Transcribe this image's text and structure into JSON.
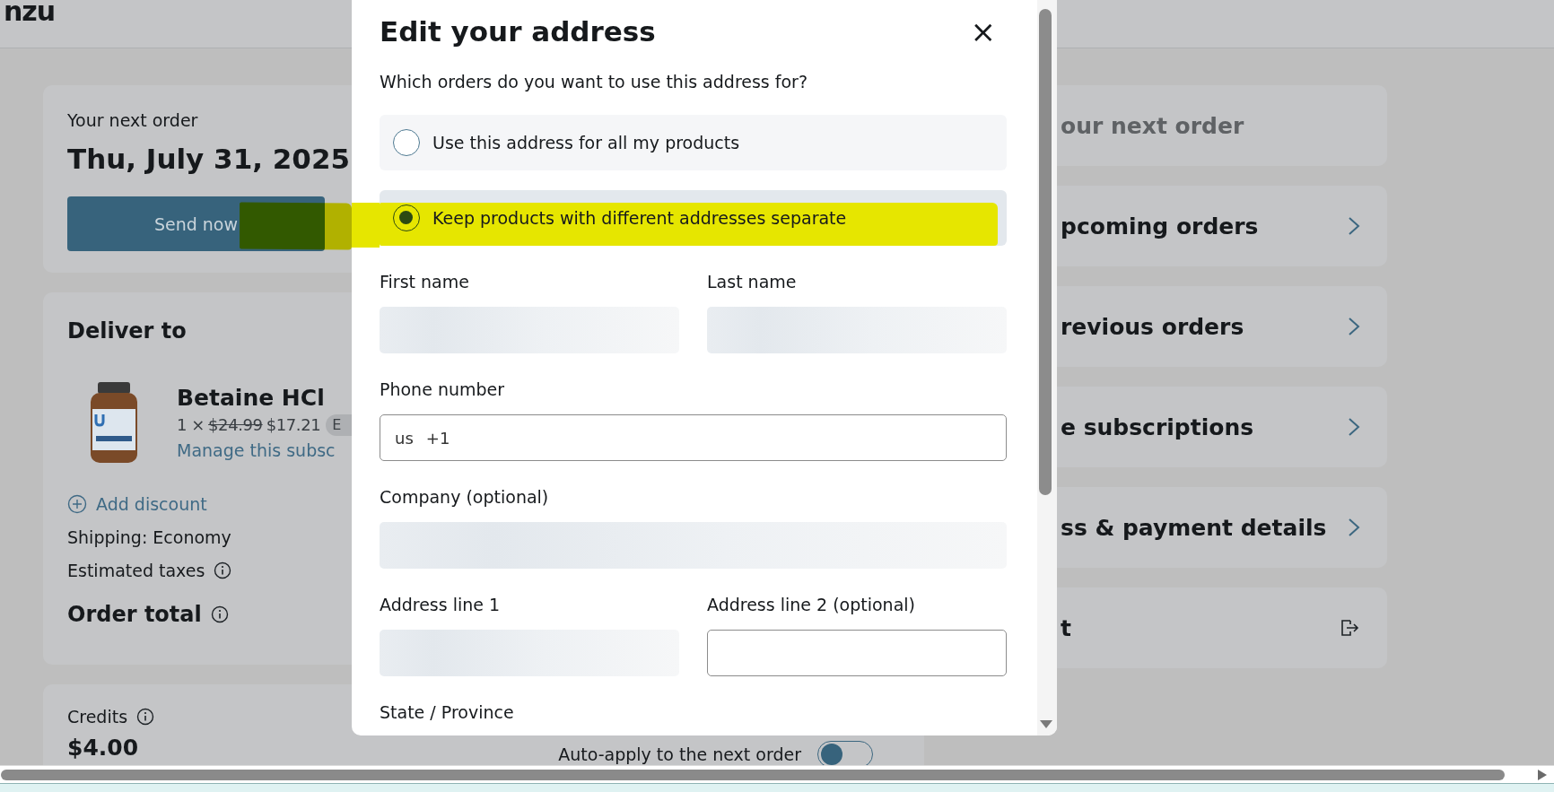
{
  "background": {
    "logo": "nzu",
    "next_order": {
      "label": "Your next order",
      "date": "Thu, July 31, 2025",
      "button": "Send now"
    },
    "delivery": {
      "title": "Deliver to",
      "product": {
        "name": "Betaine HCl",
        "quantity": "1 ×",
        "old_price": "$24.99",
        "price": "$17.21",
        "badge": "E",
        "link": "Manage this subsc"
      },
      "add_discount": "Add discount",
      "shipping": "Shipping: Economy",
      "taxes": "Estimated taxes",
      "total": "Order total"
    },
    "credits": {
      "label": "Credits",
      "amount": "$4.00",
      "auto_apply": {
        "label": "Auto-apply to the next order",
        "on": false
      }
    },
    "menu": [
      {
        "label": "our next order",
        "kind": "current"
      },
      {
        "label": "pcoming orders",
        "kind": "link"
      },
      {
        "label": "revious orders",
        "kind": "link"
      },
      {
        "label": "e subscriptions",
        "kind": "link"
      },
      {
        "label": "ss & payment details",
        "kind": "link"
      },
      {
        "label": "t",
        "kind": "logout"
      }
    ]
  },
  "dialog": {
    "title": "Edit your address",
    "close": "×",
    "question": "Which orders do you want to use this address for?",
    "options": [
      {
        "label": "Use this address for all my products",
        "selected": false
      },
      {
        "label": "Keep products with different addresses separate",
        "selected": true
      }
    ],
    "field_rows": [
      [
        {
          "label": "First name",
          "kind": "loading"
        },
        {
          "label": "Last name",
          "kind": "loading"
        }
      ],
      [
        {
          "label": "Phone number",
          "kind": "phone",
          "country": "us",
          "dial_code": "+1"
        }
      ],
      [
        {
          "label": "Company (optional)",
          "kind": "loading"
        }
      ],
      [
        {
          "label": "Address line 1",
          "kind": "loading"
        },
        {
          "label": "Address line 2 (optional)",
          "kind": "empty"
        }
      ],
      [
        {
          "label": "State / Province",
          "kind": "label_only"
        }
      ]
    ]
  }
}
